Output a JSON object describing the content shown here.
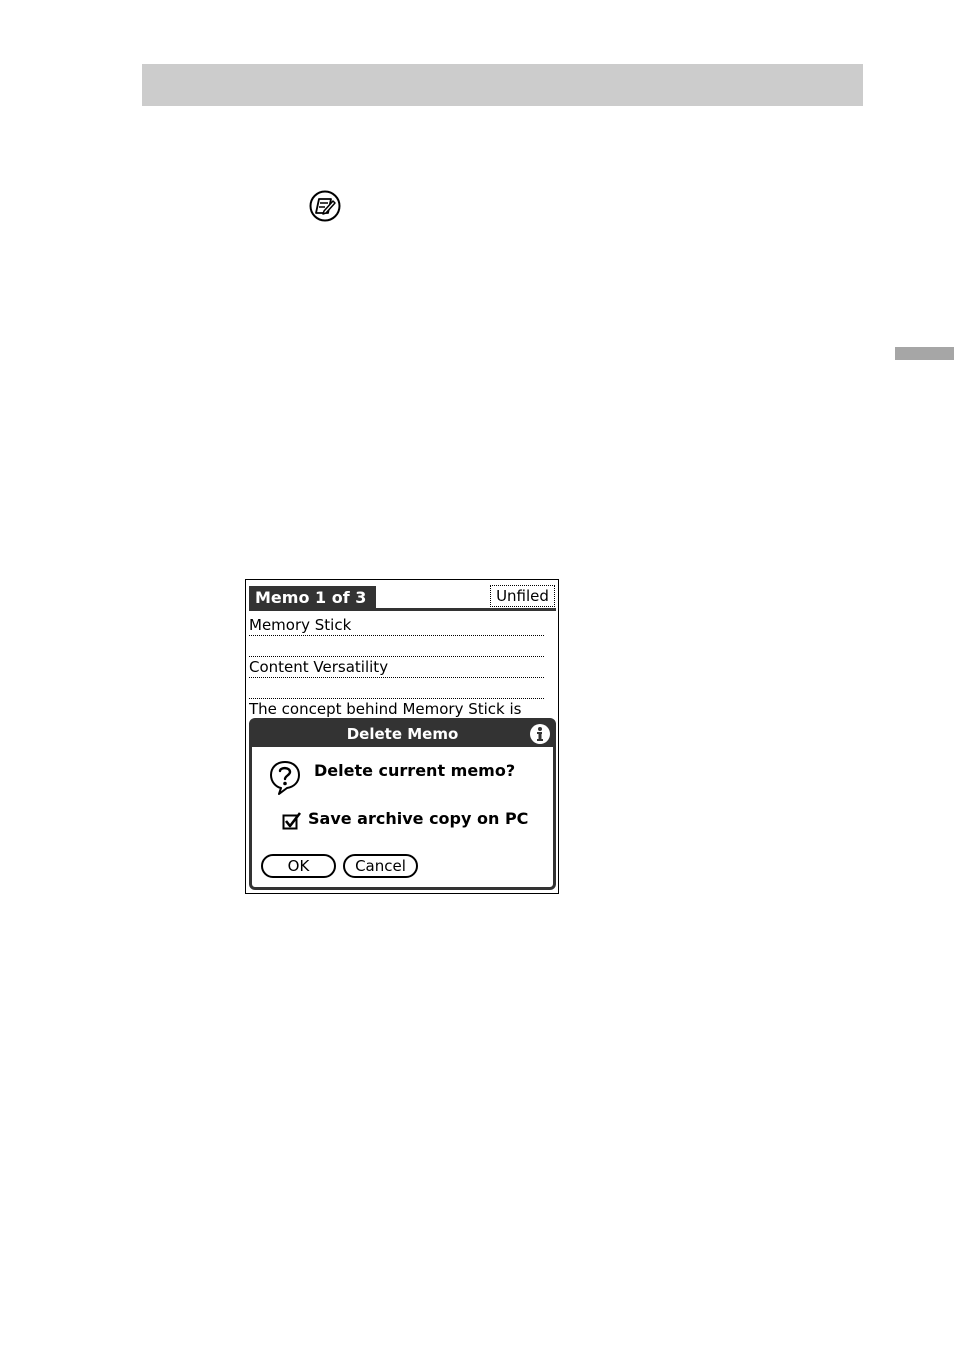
{
  "memo_screen": {
    "title": "Memo 1 of 3",
    "category": "Unfiled",
    "lines": [
      "Memory Stick",
      "",
      "Content Versatility",
      "",
      "The concept behind Memory Stick is"
    ]
  },
  "dialog": {
    "title": "Delete Memo",
    "message": "Delete current memo?",
    "checkbox_label": "Save archive copy on PC",
    "checkbox_checked": true,
    "ok_label": "OK",
    "cancel_label": "Cancel"
  },
  "icons": {
    "memo": "memo-pad-icon",
    "info": "info-icon",
    "question": "question-icon",
    "checkbox": "checkbox-checked-icon"
  },
  "colors": {
    "header_bar": "#cccccc",
    "side_tab": "#a6a6a6",
    "palm_dark": "#333333"
  }
}
